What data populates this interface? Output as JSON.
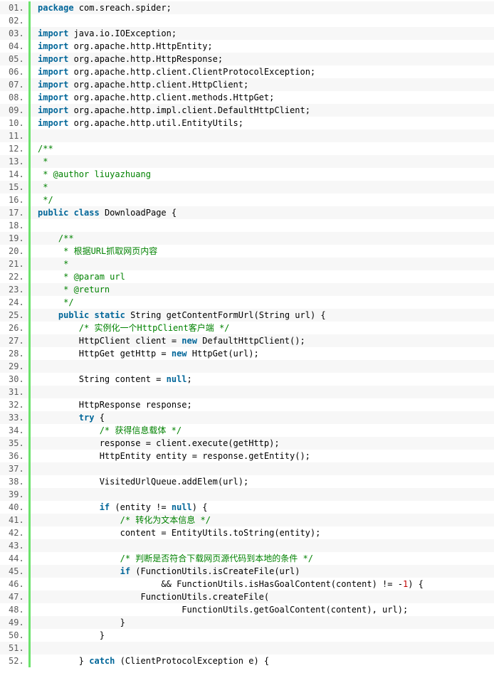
{
  "colors": {
    "keyword": "#006699",
    "comment": "#008200",
    "number": "#c00000",
    "text": "#000000",
    "gutter_bar": "#6ce26c",
    "line_number": "#5c5c5c",
    "alt_row": "#f7f7f7"
  },
  "lines": [
    {
      "num": "01.",
      "tokens": [
        {
          "t": "kw",
          "v": "package"
        },
        {
          "t": "tx",
          "v": " com.sreach.spider;"
        }
      ]
    },
    {
      "num": "02.",
      "tokens": []
    },
    {
      "num": "03.",
      "tokens": [
        {
          "t": "kw",
          "v": "import"
        },
        {
          "t": "tx",
          "v": " java.io.IOException;"
        }
      ]
    },
    {
      "num": "04.",
      "tokens": [
        {
          "t": "kw",
          "v": "import"
        },
        {
          "t": "tx",
          "v": " org.apache.http.HttpEntity;"
        }
      ]
    },
    {
      "num": "05.",
      "tokens": [
        {
          "t": "kw",
          "v": "import"
        },
        {
          "t": "tx",
          "v": " org.apache.http.HttpResponse;"
        }
      ]
    },
    {
      "num": "06.",
      "tokens": [
        {
          "t": "kw",
          "v": "import"
        },
        {
          "t": "tx",
          "v": " org.apache.http.client.ClientProtocolException;"
        }
      ]
    },
    {
      "num": "07.",
      "tokens": [
        {
          "t": "kw",
          "v": "import"
        },
        {
          "t": "tx",
          "v": " org.apache.http.client.HttpClient;"
        }
      ]
    },
    {
      "num": "08.",
      "tokens": [
        {
          "t": "kw",
          "v": "import"
        },
        {
          "t": "tx",
          "v": " org.apache.http.client.methods.HttpGet;"
        }
      ]
    },
    {
      "num": "09.",
      "tokens": [
        {
          "t": "kw",
          "v": "import"
        },
        {
          "t": "tx",
          "v": " org.apache.http.impl.client.DefaultHttpClient;"
        }
      ]
    },
    {
      "num": "10.",
      "tokens": [
        {
          "t": "kw",
          "v": "import"
        },
        {
          "t": "tx",
          "v": " org.apache.http.util.EntityUtils;"
        }
      ]
    },
    {
      "num": "11.",
      "tokens": []
    },
    {
      "num": "12.",
      "tokens": [
        {
          "t": "cm",
          "v": "/**"
        }
      ]
    },
    {
      "num": "13.",
      "tokens": [
        {
          "t": "cm",
          "v": " *"
        }
      ]
    },
    {
      "num": "14.",
      "tokens": [
        {
          "t": "cm",
          "v": " * @author liuyazhuang"
        }
      ]
    },
    {
      "num": "15.",
      "tokens": [
        {
          "t": "cm",
          "v": " *"
        }
      ]
    },
    {
      "num": "16.",
      "tokens": [
        {
          "t": "cm",
          "v": " */"
        }
      ]
    },
    {
      "num": "17.",
      "tokens": [
        {
          "t": "kw",
          "v": "public"
        },
        {
          "t": "tx",
          "v": " "
        },
        {
          "t": "kw",
          "v": "class"
        },
        {
          "t": "tx",
          "v": " DownloadPage {"
        }
      ]
    },
    {
      "num": "18.",
      "tokens": []
    },
    {
      "num": "19.",
      "tokens": [
        {
          "t": "tx",
          "v": "    "
        },
        {
          "t": "cm",
          "v": "/**"
        }
      ]
    },
    {
      "num": "20.",
      "tokens": [
        {
          "t": "tx",
          "v": "    "
        },
        {
          "t": "cm",
          "v": " * 根据URL抓取网页内容"
        }
      ]
    },
    {
      "num": "21.",
      "tokens": [
        {
          "t": "tx",
          "v": "    "
        },
        {
          "t": "cm",
          "v": " *"
        }
      ]
    },
    {
      "num": "22.",
      "tokens": [
        {
          "t": "tx",
          "v": "    "
        },
        {
          "t": "cm",
          "v": " * @param url"
        }
      ]
    },
    {
      "num": "23.",
      "tokens": [
        {
          "t": "tx",
          "v": "    "
        },
        {
          "t": "cm",
          "v": " * @return"
        }
      ]
    },
    {
      "num": "24.",
      "tokens": [
        {
          "t": "tx",
          "v": "    "
        },
        {
          "t": "cm",
          "v": " */"
        }
      ]
    },
    {
      "num": "25.",
      "tokens": [
        {
          "t": "tx",
          "v": "    "
        },
        {
          "t": "kw",
          "v": "public"
        },
        {
          "t": "tx",
          "v": " "
        },
        {
          "t": "kw",
          "v": "static"
        },
        {
          "t": "tx",
          "v": " String getContentFormUrl(String url) {"
        }
      ]
    },
    {
      "num": "26.",
      "tokens": [
        {
          "t": "tx",
          "v": "        "
        },
        {
          "t": "cm",
          "v": "/* 实例化一个HttpClient客户端 */"
        }
      ]
    },
    {
      "num": "27.",
      "tokens": [
        {
          "t": "tx",
          "v": "        HttpClient client = "
        },
        {
          "t": "kw",
          "v": "new"
        },
        {
          "t": "tx",
          "v": " DefaultHttpClient();"
        }
      ]
    },
    {
      "num": "28.",
      "tokens": [
        {
          "t": "tx",
          "v": "        HttpGet getHttp = "
        },
        {
          "t": "kw",
          "v": "new"
        },
        {
          "t": "tx",
          "v": " HttpGet(url);"
        }
      ]
    },
    {
      "num": "29.",
      "tokens": []
    },
    {
      "num": "30.",
      "tokens": [
        {
          "t": "tx",
          "v": "        String content = "
        },
        {
          "t": "kw",
          "v": "null"
        },
        {
          "t": "tx",
          "v": ";"
        }
      ]
    },
    {
      "num": "31.",
      "tokens": []
    },
    {
      "num": "32.",
      "tokens": [
        {
          "t": "tx",
          "v": "        HttpResponse response;"
        }
      ]
    },
    {
      "num": "33.",
      "tokens": [
        {
          "t": "tx",
          "v": "        "
        },
        {
          "t": "kw",
          "v": "try"
        },
        {
          "t": "tx",
          "v": " {"
        }
      ]
    },
    {
      "num": "34.",
      "tokens": [
        {
          "t": "tx",
          "v": "            "
        },
        {
          "t": "cm",
          "v": "/* 获得信息载体 */"
        }
      ]
    },
    {
      "num": "35.",
      "tokens": [
        {
          "t": "tx",
          "v": "            response = client.execute(getHttp);"
        }
      ]
    },
    {
      "num": "36.",
      "tokens": [
        {
          "t": "tx",
          "v": "            HttpEntity entity = response.getEntity();"
        }
      ]
    },
    {
      "num": "37.",
      "tokens": []
    },
    {
      "num": "38.",
      "tokens": [
        {
          "t": "tx",
          "v": "            VisitedUrlQueue.addElem(url);"
        }
      ]
    },
    {
      "num": "39.",
      "tokens": []
    },
    {
      "num": "40.",
      "tokens": [
        {
          "t": "tx",
          "v": "            "
        },
        {
          "t": "kw",
          "v": "if"
        },
        {
          "t": "tx",
          "v": " (entity != "
        },
        {
          "t": "kw",
          "v": "null"
        },
        {
          "t": "tx",
          "v": ") {"
        }
      ]
    },
    {
      "num": "41.",
      "tokens": [
        {
          "t": "tx",
          "v": "                "
        },
        {
          "t": "cm",
          "v": "/* 转化为文本信息 */"
        }
      ]
    },
    {
      "num": "42.",
      "tokens": [
        {
          "t": "tx",
          "v": "                content = EntityUtils.toString(entity);"
        }
      ]
    },
    {
      "num": "43.",
      "tokens": []
    },
    {
      "num": "44.",
      "tokens": [
        {
          "t": "tx",
          "v": "                "
        },
        {
          "t": "cm",
          "v": "/* 判断是否符合下载网页源代码到本地的条件 */"
        }
      ]
    },
    {
      "num": "45.",
      "tokens": [
        {
          "t": "tx",
          "v": "                "
        },
        {
          "t": "kw",
          "v": "if"
        },
        {
          "t": "tx",
          "v": " (FunctionUtils.isCreateFile(url)"
        }
      ]
    },
    {
      "num": "46.",
      "tokens": [
        {
          "t": "tx",
          "v": "                        && FunctionUtils.isHasGoalContent(content) != -"
        },
        {
          "t": "nm",
          "v": "1"
        },
        {
          "t": "tx",
          "v": ") {"
        }
      ]
    },
    {
      "num": "47.",
      "tokens": [
        {
          "t": "tx",
          "v": "                    FunctionUtils.createFile("
        }
      ]
    },
    {
      "num": "48.",
      "tokens": [
        {
          "t": "tx",
          "v": "                            FunctionUtils.getGoalContent(content), url);"
        }
      ]
    },
    {
      "num": "49.",
      "tokens": [
        {
          "t": "tx",
          "v": "                }"
        }
      ]
    },
    {
      "num": "50.",
      "tokens": [
        {
          "t": "tx",
          "v": "            }"
        }
      ]
    },
    {
      "num": "51.",
      "tokens": []
    },
    {
      "num": "52.",
      "tokens": [
        {
          "t": "tx",
          "v": "        } "
        },
        {
          "t": "kw",
          "v": "catch"
        },
        {
          "t": "tx",
          "v": " (ClientProtocolException e) {"
        }
      ]
    }
  ]
}
